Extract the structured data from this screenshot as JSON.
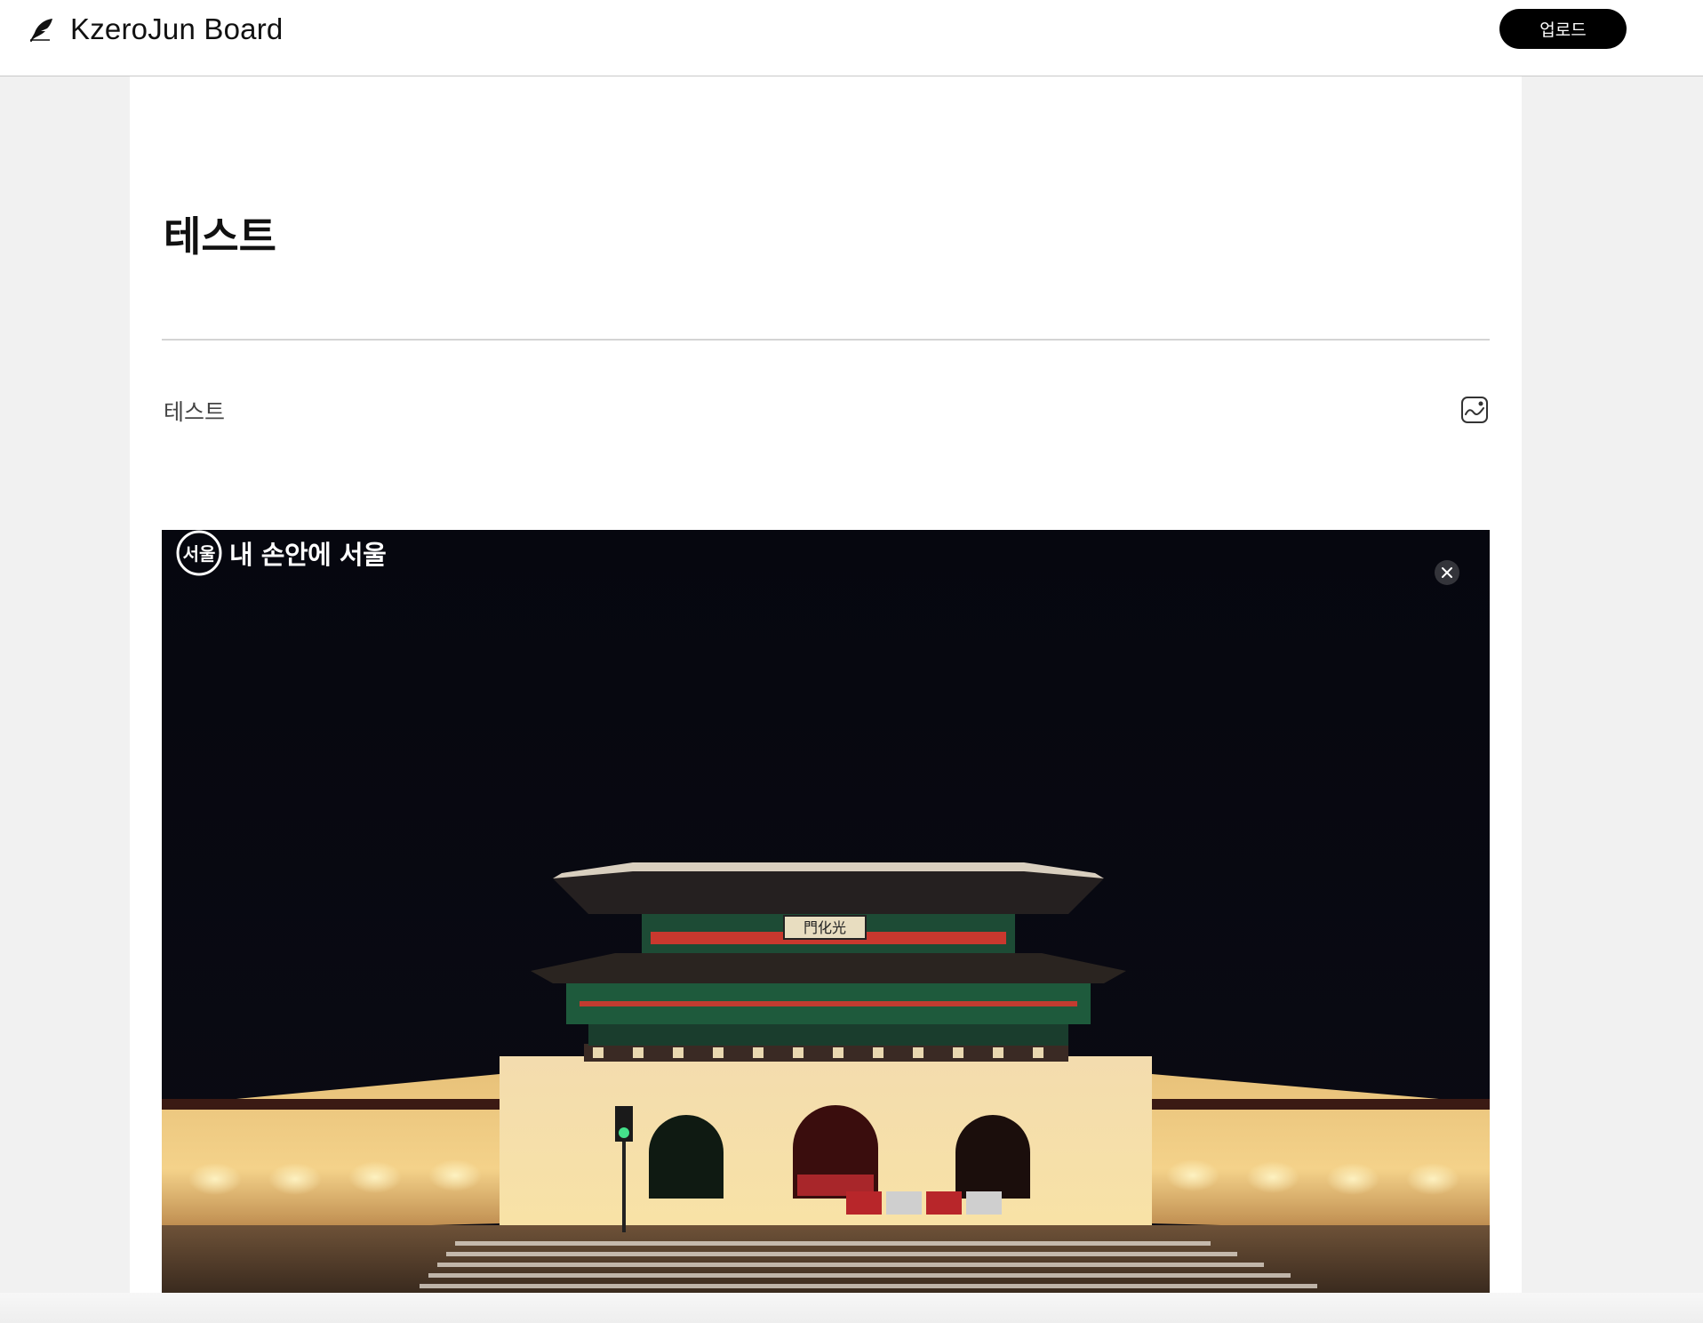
{
  "header": {
    "brand": "KzeroJun Board",
    "logo_icon": "feather-pen-icon",
    "upload_label": "업로드"
  },
  "post": {
    "title": "테스트",
    "body": "테스트",
    "image_insert_icon": "image-icon"
  },
  "attachment": {
    "caption_badge": "서울",
    "caption": "내 손안에 서울",
    "remove_icon": "close-icon",
    "plaque": "門化光"
  },
  "colors": {
    "header_bg": "#ffffff",
    "page_bg": "#f1f1f1",
    "button_bg": "#000000",
    "button_text": "#ffffff",
    "night_sky": "#05060d"
  }
}
